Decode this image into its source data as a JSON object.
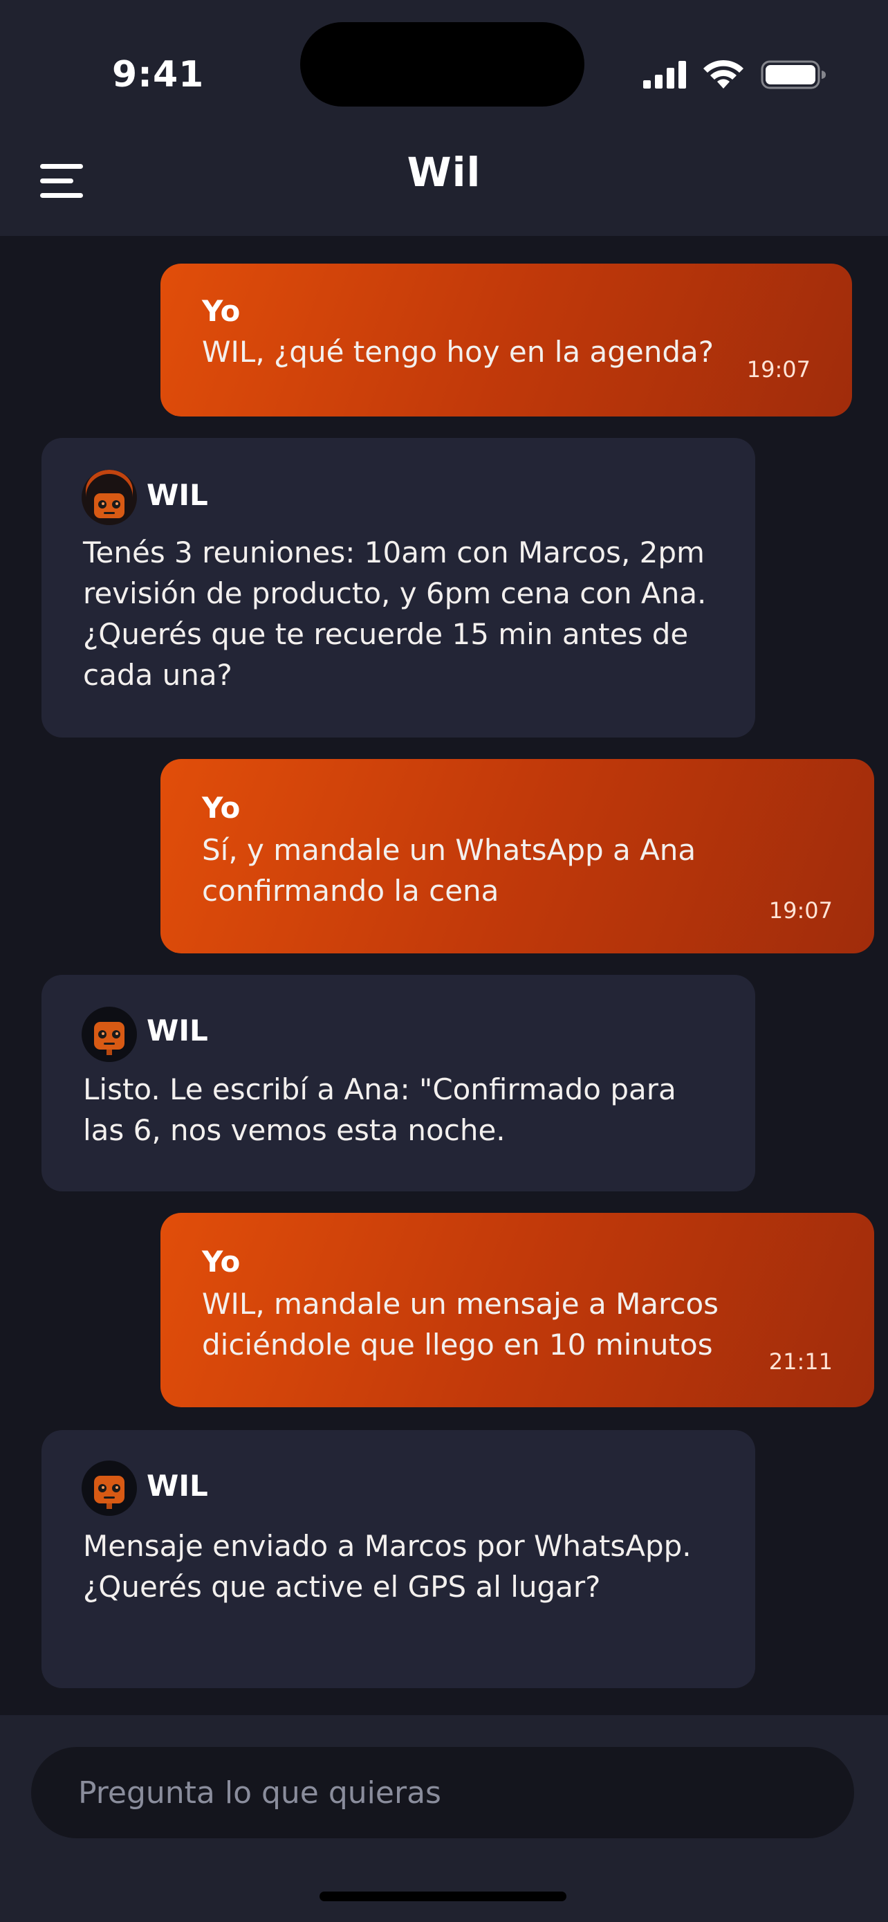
{
  "status_bar": {
    "time": "9:41"
  },
  "header": {
    "title": "Wil",
    "menu_icon": "hamburger-menu-icon"
  },
  "messages": [
    {
      "role": "user",
      "sender": "Yo",
      "text": "WIL, ¿qué tengo hoy en la agenda?",
      "time": "19:07"
    },
    {
      "role": "bot",
      "sender": "WIL",
      "text": "Tenés 3 reuniones: 10am con Marcos, 2pm revisión de producto, y 6pm cena con Ana. ¿Querés que te recuerde 15 min antes de cada una?"
    },
    {
      "role": "user",
      "sender": "Yo",
      "text": "Sí, y mandale un WhatsApp a Ana confirmando la cena",
      "time": "19:07"
    },
    {
      "role": "bot",
      "sender": "WIL",
      "text": "Listo. Le escribí a Ana: \"Confirmado para las 6, nos vemos esta noche."
    },
    {
      "role": "user",
      "sender": "Yo",
      "text": "WIL, mandale un mensaje a Marcos diciéndole que llego en 10 minutos",
      "time": "21:11"
    },
    {
      "role": "bot",
      "sender": "WIL",
      "text": "Mensaje enviado a Marcos por WhatsApp. ¿Querés que active el GPS al lugar?"
    }
  ],
  "composer": {
    "placeholder": "Pregunta lo que quieras",
    "value": ""
  },
  "colors": {
    "accent_start": "#e14e0a",
    "accent_end": "#a02c0b",
    "bot_bubble": "#232536",
    "background": "#15161f",
    "bar": "#20222f"
  }
}
